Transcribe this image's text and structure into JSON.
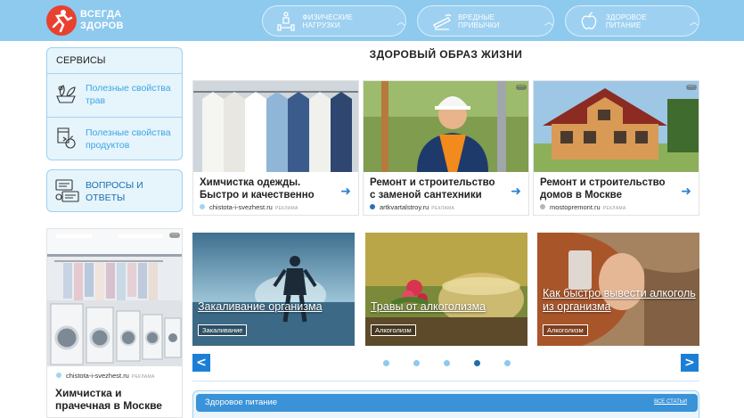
{
  "header": {
    "logo_line1": "ВСЕГДА",
    "logo_line2": "ЗДОРОВ",
    "nav": [
      {
        "label": "ФИЗИЧЕСКИЕ НАГРУЗКИ",
        "icon": "dumbbell-icon"
      },
      {
        "label": "ВРЕДНЫЕ ПРИВЫЧКИ",
        "icon": "cigarette-icon"
      },
      {
        "label": "ЗДОРОВОЕ ПИТАНИЕ",
        "icon": "apple-icon"
      }
    ]
  },
  "sidebar": {
    "services_title": "СЕРВИСЫ",
    "items": [
      {
        "label": "Полезные свойства трав",
        "icon": "herbs-icon"
      },
      {
        "label": "Полезные свойства продуктов",
        "icon": "products-icon"
      }
    ],
    "qa_label": "ВОПРОСЫ И ОТВЕТЫ",
    "ad": {
      "source": "chistota-i-svezhest.ru",
      "ad_tag": "РЕКЛАМА",
      "title": "Химчистка и прачечная в Москве"
    }
  },
  "main": {
    "title": "ЗДОРОВЫЙ ОБРАЗ ЖИЗНИ",
    "ads": [
      {
        "title": "Химчистка одежды. Быстро и качественно",
        "source": "chistota-i-svezhest.ru",
        "ad_tag": "РЕКЛАМА"
      },
      {
        "title": "Ремонт и строительство с заменой сантехники",
        "source": "artkvartalstroy.ru",
        "ad_tag": "РЕКЛАМА"
      },
      {
        "title": "Ремонт и строительство домов в Москве",
        "source": "mostopremont.ru",
        "ad_tag": "РЕКЛАМА"
      }
    ],
    "articles": [
      {
        "caption": "Закаливание организма",
        "tag": "Закаливание"
      },
      {
        "caption": "Травы от алкоголизма",
        "tag": "Алкоголизм"
      },
      {
        "caption": "Как быстро вывести алкоголь из организма",
        "tag": "Алкоголизм"
      }
    ],
    "slider": {
      "prev": "<",
      "next": ">",
      "dot_count": 5,
      "active_index": 3
    },
    "section": {
      "title": "Здоровое питание",
      "all_link": "ВСЕ СТАТЬИ"
    }
  },
  "colors": {
    "header_bg": "#8ec9ee",
    "accent_blue": "#1c7fd6",
    "logo_red": "#e8412f",
    "link_blue": "#3aa6e6"
  }
}
